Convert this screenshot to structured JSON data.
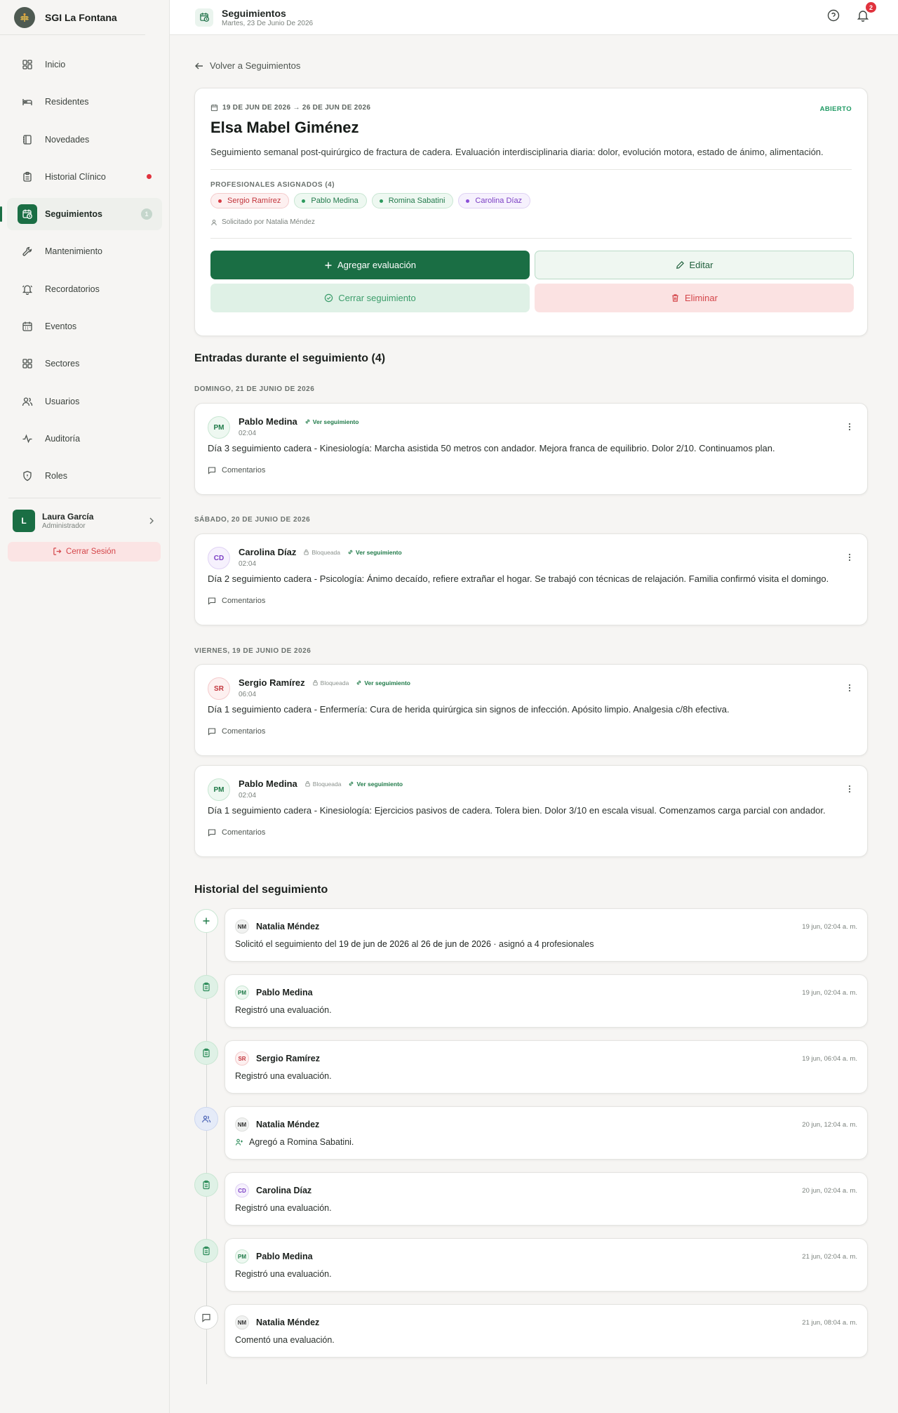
{
  "brand": {
    "name": "SGI La Fontana"
  },
  "sidebar": {
    "items": [
      {
        "label": "Inicio",
        "icon": "dashboard-icon"
      },
      {
        "label": "Residentes",
        "icon": "bed-icon"
      },
      {
        "label": "Novedades",
        "icon": "notebook-icon"
      },
      {
        "label": "Historial Clínico",
        "icon": "clipboard-icon"
      },
      {
        "label": "Seguimientos",
        "icon": "calendar-clock-icon",
        "badge": "1"
      },
      {
        "label": "Mantenimiento",
        "icon": "wrench-icon"
      },
      {
        "label": "Recordatorios",
        "icon": "bell-icon"
      },
      {
        "label": "Eventos",
        "icon": "calendar-icon"
      },
      {
        "label": "Sectores",
        "icon": "grid-icon"
      },
      {
        "label": "Usuarios",
        "icon": "users-icon"
      },
      {
        "label": "Auditoría",
        "icon": "activity-icon"
      },
      {
        "label": "Roles",
        "icon": "shield-icon"
      }
    ],
    "user": {
      "initial": "L",
      "name": "Laura García",
      "role": "Administrador"
    },
    "logout_label": "Cerrar Sesión"
  },
  "header": {
    "title": "Seguimientos",
    "subtitle": "Martes, 23 De Junio De 2026",
    "notifications_count": "2"
  },
  "back_link": "Volver a Seguimientos",
  "summary": {
    "date_range": "19 DE JUN DE 2026 → 26 DE JUN DE 2026",
    "status": "ABIERTO",
    "resident": "Elsa Mabel Giménez",
    "description": "Seguimiento semanal post-quirúrgico de fractura de cadera. Evaluación interdisciplinaria diaria: dolor, evolución motora, estado de ánimo, alimentación.",
    "assigned_title": "PROFESIONALES ASIGNADOS (4)",
    "professionals": [
      "Sergio Ramírez",
      "Pablo Medina",
      "Romina Sabatini",
      "Carolina Díaz"
    ],
    "requested_by": "Solicitado por Natalia Méndez",
    "buttons": {
      "add": "Agregar evaluación",
      "edit": "Editar",
      "close": "Cerrar seguimiento",
      "delete": "Eliminar"
    }
  },
  "entries_section": {
    "title": "Entradas durante el seguimiento (4)",
    "days": [
      "DOMINGO, 21 DE JUNIO DE 2026",
      "SÁBADO, 20 DE JUNIO DE 2026",
      "VIERNES, 19 DE JUNIO DE 2026"
    ],
    "lock_label": "Bloqueada",
    "link_label": "Ver seguimiento",
    "comments_label": "Comentarios",
    "entries": [
      {
        "initials": "PM",
        "name": "Pablo Medina",
        "time": "02:04",
        "text": "Día 3 seguimiento cadera - Kinesiología: Marcha asistida 50 metros con andador. Mejora franca de equilibrio. Dolor 2/10. Continuamos plan."
      },
      {
        "initials": "CD",
        "name": "Carolina Díaz",
        "time": "02:04",
        "text": "Día 2 seguimiento cadera - Psicología: Ánimo decaído, refiere extrañar el hogar. Se trabajó con técnicas de relajación. Familia confirmó visita el domingo."
      },
      {
        "initials": "SR",
        "name": "Sergio Ramírez",
        "time": "06:04",
        "text": "Día 1 seguimiento cadera - Enfermería: Cura de herida quirúrgica sin signos de infección. Apósito limpio. Analgesia c/8h efectiva."
      },
      {
        "initials": "PM",
        "name": "Pablo Medina",
        "time": "02:04",
        "text": "Día 1 seguimiento cadera - Kinesiología: Ejercicios pasivos de cadera. Tolera bien. Dolor 3/10 en escala visual. Comenzamos carga parcial con andador."
      }
    ]
  },
  "history": {
    "title": "Historial del seguimiento",
    "items": [
      {
        "initials": "NM",
        "name": "Natalia Méndez",
        "time": "19 jun, 02:04 a. m.",
        "text_before": "Solicitó el seguimiento del ",
        "from": "19 de jun de 2026",
        "middle": " al ",
        "to": "26 de jun de 2026",
        "text_after": " · asignó a 4 profesionales"
      },
      {
        "initials": "PM",
        "name": "Pablo Medina",
        "time": "19 jun, 02:04 a. m.",
        "text": "Registró una evaluación."
      },
      {
        "initials": "SR",
        "name": "Sergio Ramírez",
        "time": "19 jun, 06:04 a. m.",
        "text": "Registró una evaluación."
      },
      {
        "initials": "NM",
        "name": "Natalia Méndez",
        "time": "20 jun, 12:04 a. m.",
        "text": "Agregó a Romina Sabatini."
      },
      {
        "initials": "CD",
        "name": "Carolina Díaz",
        "time": "20 jun, 02:04 a. m.",
        "text": "Registró una evaluación."
      },
      {
        "initials": "PM",
        "name": "Pablo Medina",
        "time": "21 jun, 02:04 a. m.",
        "text": "Registró una evaluación."
      },
      {
        "initials": "NM",
        "name": "Natalia Méndez",
        "time": "21 jun, 08:04 a. m.",
        "text": "Comentó una evaluación."
      }
    ]
  }
}
